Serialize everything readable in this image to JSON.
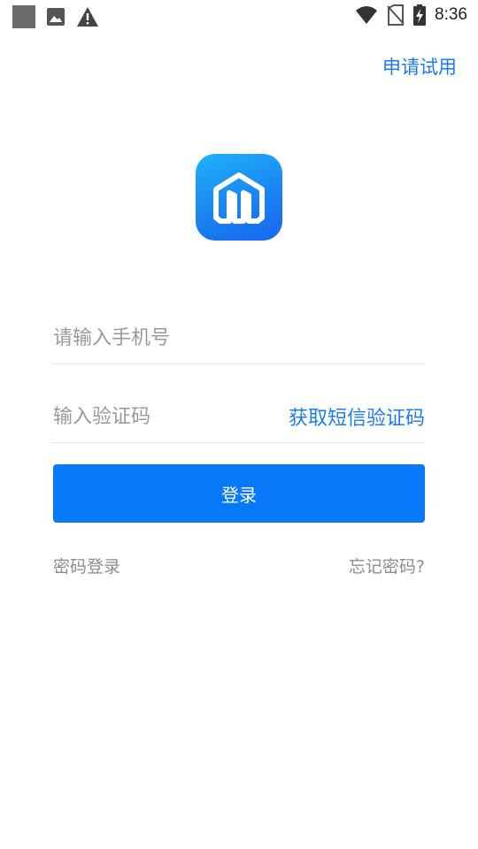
{
  "status_bar": {
    "left_icons": [
      "square-notification-icon",
      "image-notification-icon",
      "warning-icon"
    ],
    "right_icons": [
      "wifi-icon",
      "no-sim-icon",
      "battery-charging-icon"
    ],
    "time": "8:36"
  },
  "header": {
    "apply_trial": "申请试用"
  },
  "logo": {
    "icon": "app-logo-icon"
  },
  "form": {
    "phone_placeholder": "请输入手机号",
    "code_placeholder": "输入验证码",
    "sms_button": "获取短信验证码",
    "login_button": "登录"
  },
  "footer_links": {
    "password_login": "密码登录",
    "forgot_password": "忘记密码?"
  },
  "colors": {
    "accent": "#1a7cf0",
    "button": "#0879f9",
    "placeholder": "#9a9a9a",
    "secondary_text": "#8c8c8c"
  }
}
